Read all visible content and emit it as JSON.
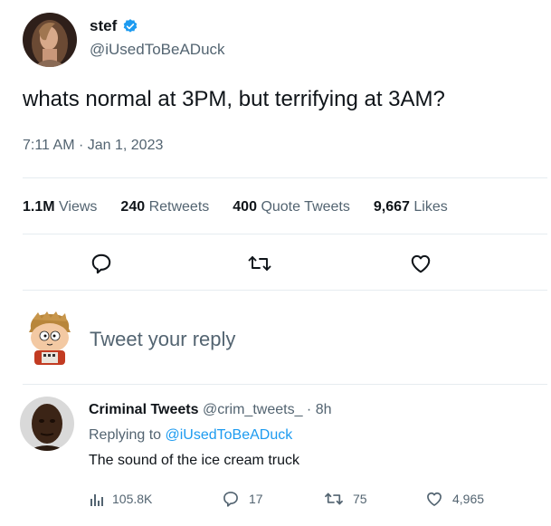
{
  "tweet": {
    "author_name": "stef",
    "verified_icon": "verified-badge-icon",
    "handle": "@iUsedToBeADuck",
    "text": "whats normal at 3PM, but terrifying at 3AM?",
    "timestamp": "7:11 AM · Jan 1, 2023"
  },
  "stats": {
    "views_count": "1.1M",
    "views_label": "Views",
    "retweets_count": "240",
    "retweets_label": "Retweets",
    "quotes_count": "400",
    "quotes_label": "Quote Tweets",
    "likes_count": "9,667",
    "likes_label": "Likes"
  },
  "actions": {
    "reply_icon": "reply-icon",
    "retweet_icon": "retweet-icon",
    "like_icon": "heart-icon"
  },
  "reply_box": {
    "placeholder": "Tweet your reply"
  },
  "reply": {
    "author_name": "Criminal Tweets",
    "handle": "@crim_tweets_",
    "separator": " · ",
    "age": "8h",
    "replying_prefix": "Replying to ",
    "replying_to": "@iUsedToBeADuck",
    "text": "The sound of the ice cream truck",
    "views": "105.8K",
    "replies": "17",
    "retweets": "75",
    "likes": "4,965"
  },
  "colors": {
    "accent": "#1d9bf0",
    "text": "#0f1419",
    "secondary": "#536471",
    "divider": "#e6ecf0"
  }
}
